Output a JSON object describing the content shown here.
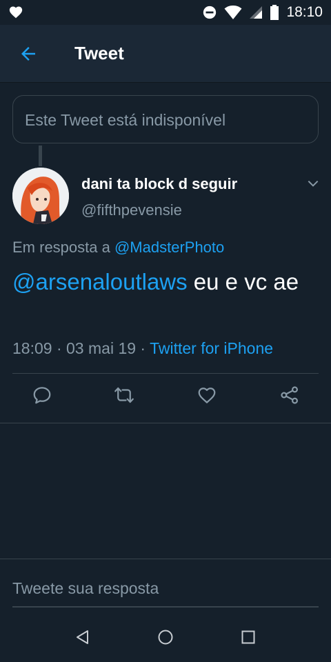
{
  "status_bar": {
    "time": "18:10",
    "icons": [
      "heart-icon",
      "do-not-disturb-icon",
      "wifi-icon",
      "signal-icon",
      "battery-icon"
    ]
  },
  "app_bar": {
    "title": "Tweet",
    "back_icon": "back-arrow-icon"
  },
  "quoted": {
    "unavailable_text": "Este Tweet está indisponível"
  },
  "tweet": {
    "display_name": "dani ta block d seguir",
    "handle": "@fifthpevensie",
    "reply_prefix": "Em resposta a",
    "reply_to": "@MadsterPhoto",
    "mention": "@arsenaloutlaws",
    "text": " eu e vc ae",
    "time": "18:09",
    "date": "03 mai 19",
    "separator": "·",
    "source": "Twitter for iPhone"
  },
  "actions": [
    "reply-icon",
    "retweet-icon",
    "like-icon",
    "share-icon"
  ],
  "composer": {
    "placeholder": "Tweete sua resposta"
  },
  "nav_bar": [
    "back-triangle-icon",
    "home-circle-icon",
    "recents-square-icon"
  ],
  "colors": {
    "background": "#15202b",
    "app_bar": "#1b2836",
    "accent": "#1da1f2",
    "secondary_text": "#8899a6",
    "border": "#38444d"
  }
}
